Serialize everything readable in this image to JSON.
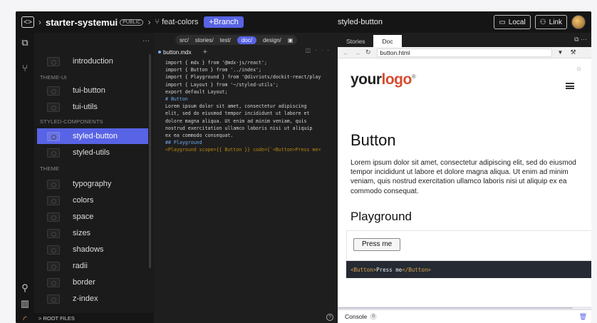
{
  "topbar": {
    "repo_name": "starter-systemui",
    "visibility_badge": "PUBLIC",
    "branch_name": "feat-colors",
    "new_branch_label": "+Branch",
    "preview_title": "styled-button",
    "local_label": "Local",
    "link_label": "Link"
  },
  "tree": {
    "items": [
      {
        "label": "introduction"
      },
      {
        "label": "tui-button"
      },
      {
        "label": "tui-utils"
      },
      {
        "label": "styled-button"
      },
      {
        "label": "styled-utils"
      },
      {
        "label": "typography"
      },
      {
        "label": "colors"
      },
      {
        "label": "space"
      },
      {
        "label": "sizes"
      },
      {
        "label": "shadows"
      },
      {
        "label": "radii"
      },
      {
        "label": "border"
      },
      {
        "label": "z-index"
      }
    ],
    "sections": [
      "THEME-UI",
      "STYLED-COMPONENTS",
      "THEME"
    ],
    "active_item": "styled-button",
    "root_files_label": "> ROOT FILES"
  },
  "editor": {
    "path_segments": [
      "src/",
      "stories/",
      "test/",
      "doc/",
      "design/"
    ],
    "active_segment": "doc/",
    "file_tab": "button.mdx",
    "code_lines": [
      "import { mdx } from '@mdx-js/react';",
      "import { Button } from '../index';",
      "import { Playground } from '@divriots/dockit-react/play",
      "import { Layout } from '~/styled-utils';",
      "export default Layout;",
      "",
      "# Button",
      "",
      "Lorem ipsum dolor sit amet, consectetur adipiscing",
      "elit, sed do eiusmod tempor incididunt ut labore et",
      "dolore magna aliqua. Ut enim ad minim veniam, quis",
      "nostrud exercitation ullamco laboris nisi ut aliquip",
      "ex ea commodo consequat.",
      "",
      "## Playground",
      "",
      "<Playground scope={{ Button }} code={`<Button>Press me<"
    ]
  },
  "preview": {
    "tabs": [
      "Stories",
      "Doc"
    ],
    "active_tab": "Doc",
    "url": "button.html",
    "logo_text_a": "your",
    "logo_text_b": "logo",
    "logo_reg": "®",
    "heading": "Button",
    "paragraph": "Lorem ipsum dolor sit amet, consectetur adipiscing elit, sed do eiusmod tempor incididunt ut labore et dolore magna aliqua. Ut enim ad minim veniam, quis nostrud exercitation ullamco laboris nisi ut aliquip ex ea commodo consequat.",
    "subheading": "Playground",
    "button_label": "Press me",
    "code_open": "<Button>",
    "code_text": "Press me",
    "code_close": "</Button>",
    "console_label": "Console",
    "console_count": "0"
  },
  "colors": {
    "accent": "#5863e5",
    "logo_accent": "#d64c2f"
  }
}
